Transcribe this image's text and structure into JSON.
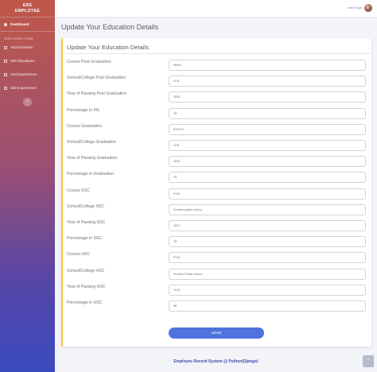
{
  "sidebar": {
    "brand_line1": "ERS",
    "brand_line2": "EMPLOYEE",
    "dashboard_label": "Dashboard",
    "section_heading": "EMPLOYEES FORM",
    "items": [
      {
        "label": "Add Education"
      },
      {
        "label": "Edit Educations"
      },
      {
        "label": "Add Experiences"
      },
      {
        "label": "Edit Experiences"
      }
    ],
    "collapse_glyph": "‹"
  },
  "topbar": {
    "user_name": "rahul Singh"
  },
  "page": {
    "title": "Update Your Education Details",
    "card_title": "Update Your Education Details"
  },
  "form": {
    "fields": [
      {
        "label": "Course Post Graduation",
        "value": "Mtech"
      },
      {
        "label": "School/College Post Graduation",
        "value": "LPU"
      },
      {
        "label": "Year of Passing Post Graduation",
        "value": "2026"
      },
      {
        "label": "Percentage in PG",
        "value": "78"
      },
      {
        "label": "Course Graduation",
        "value": "BTECH"
      },
      {
        "label": "School/College Graduation",
        "value": "LPU"
      },
      {
        "label": "Year of Passing Graduation",
        "value": "2022"
      },
      {
        "label": "Percentage in Graduation",
        "value": "76"
      },
      {
        "label": "Course SSC",
        "value": "PCM"
      },
      {
        "label": "School/College SSC",
        "value": "Sunrise public school"
      },
      {
        "label": "Year of Passing SSC",
        "value": "2017"
      },
      {
        "label": "Percentage in SSC",
        "value": "78"
      },
      {
        "label": "Course HSC",
        "value": "PCM"
      },
      {
        "label": "School/College HSC",
        "value": "Sunrise Public school"
      },
      {
        "label": "Year of Passing HSC",
        "value": "2019"
      },
      {
        "label": "Percentage in HSC",
        "value": "86"
      }
    ],
    "submit_label": "submit"
  },
  "footer": {
    "text": "Employee Record System @ Python(Django)"
  },
  "scroll_top_glyph": "^"
}
